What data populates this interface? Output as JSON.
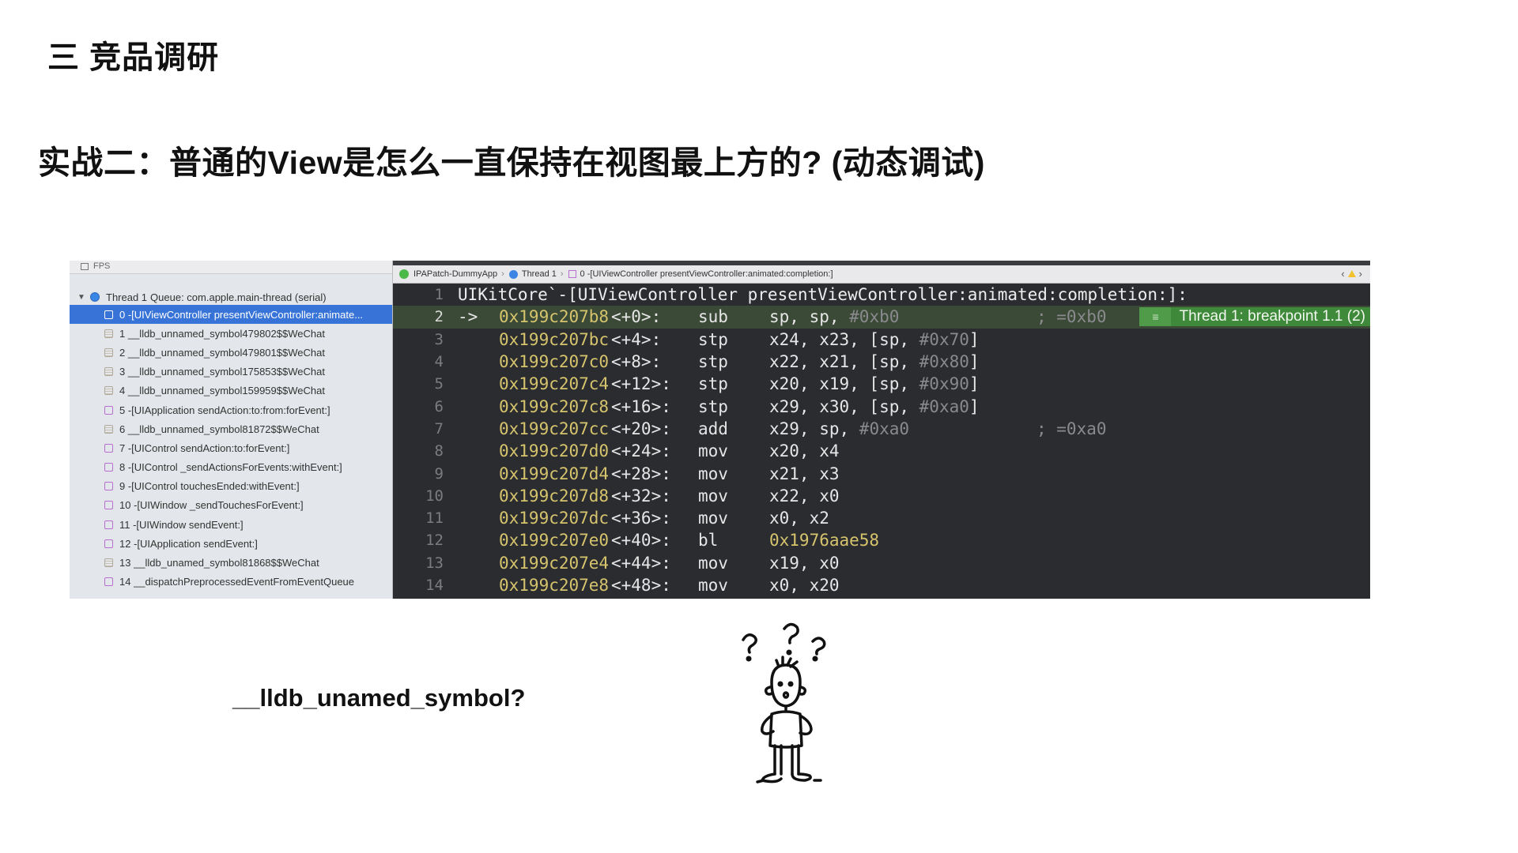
{
  "slide": {
    "section_title": "三 竞品调研",
    "heading": "实战二：普通的View是怎么一直保持在视图最上方的? (动态调试)",
    "question": "__lldb_unamed_symbol?"
  },
  "navigator": {
    "toolbar_label": "FPS",
    "thread_label": "Thread 1",
    "thread_queue": "Queue: com.apple.main-thread (serial)",
    "frames": [
      {
        "label": "0 -[UIViewController presentViewController:animate...",
        "kind": "objc",
        "selected": true
      },
      {
        "label": "1 __lldb_unnamed_symbol479802$$WeChat",
        "kind": "sym"
      },
      {
        "label": "2 __lldb_unnamed_symbol479801$$WeChat",
        "kind": "sym"
      },
      {
        "label": "3 __lldb_unnamed_symbol175853$$WeChat",
        "kind": "sym"
      },
      {
        "label": "4 __lldb_unnamed_symbol159959$$WeChat",
        "kind": "sym"
      },
      {
        "label": "5 -[UIApplication sendAction:to:from:forEvent:]",
        "kind": "objc"
      },
      {
        "label": "6 __lldb_unnamed_symbol81872$$WeChat",
        "kind": "sym"
      },
      {
        "label": "7 -[UIControl sendAction:to:forEvent:]",
        "kind": "objc"
      },
      {
        "label": "8 -[UIControl _sendActionsForEvents:withEvent:]",
        "kind": "objc"
      },
      {
        "label": "9 -[UIControl touchesEnded:withEvent:]",
        "kind": "objc"
      },
      {
        "label": "10 -[UIWindow _sendTouchesForEvent:]",
        "kind": "objc"
      },
      {
        "label": "11 -[UIWindow sendEvent:]",
        "kind": "objc"
      },
      {
        "label": "12 -[UIApplication sendEvent:]",
        "kind": "objc"
      },
      {
        "label": "13 __lldb_unamed_symbol81868$$WeChat",
        "kind": "sym"
      },
      {
        "label": "14 __dispatchPreprocessedEventFromEventQueue",
        "kind": "objc"
      }
    ]
  },
  "jumpbar": {
    "app": "IPAPatch-DummyApp",
    "thread": "Thread 1",
    "frame": "0 -[UIViewController presentViewController:animated:completion:]"
  },
  "disassembly": {
    "header": {
      "line": "1",
      "text": "UIKitCore`-[UIViewController presentViewController:animated:completion:]:"
    },
    "breakpoint_label": "Thread 1: breakpoint 1.1 (2)",
    "lines": [
      {
        "ln": "2",
        "arrow": "->",
        "addr": "0x199c207b8",
        "off": "<+0>:",
        "mnem": "sub",
        "ops": "sp, sp, ",
        "imm": "#0xb0",
        "comment": "; =0xb0",
        "current": true
      },
      {
        "ln": "3",
        "arrow": "",
        "addr": "0x199c207bc",
        "off": "<+4>:",
        "mnem": "stp",
        "ops": "x24, x23, [sp, ",
        "imm": "#0x70",
        "tail": "]",
        "comment": ""
      },
      {
        "ln": "4",
        "arrow": "",
        "addr": "0x199c207c0",
        "off": "<+8>:",
        "mnem": "stp",
        "ops": "x22, x21, [sp, ",
        "imm": "#0x80",
        "tail": "]",
        "comment": ""
      },
      {
        "ln": "5",
        "arrow": "",
        "addr": "0x199c207c4",
        "off": "<+12>:",
        "mnem": "stp",
        "ops": "x20, x19, [sp, ",
        "imm": "#0x90",
        "tail": "]",
        "comment": ""
      },
      {
        "ln": "6",
        "arrow": "",
        "addr": "0x199c207c8",
        "off": "<+16>:",
        "mnem": "stp",
        "ops": "x29, x30, [sp, ",
        "imm": "#0xa0",
        "tail": "]",
        "comment": ""
      },
      {
        "ln": "7",
        "arrow": "",
        "addr": "0x199c207cc",
        "off": "<+20>:",
        "mnem": "add",
        "ops": "x29, sp, ",
        "imm": "#0xa0",
        "comment": "; =0xa0"
      },
      {
        "ln": "8",
        "arrow": "",
        "addr": "0x199c207d0",
        "off": "<+24>:",
        "mnem": "mov",
        "ops": "x20, x4",
        "comment": ""
      },
      {
        "ln": "9",
        "arrow": "",
        "addr": "0x199c207d4",
        "off": "<+28>:",
        "mnem": "mov",
        "ops": "x21, x3",
        "comment": ""
      },
      {
        "ln": "10",
        "arrow": "",
        "addr": "0x199c207d8",
        "off": "<+32>:",
        "mnem": "mov",
        "ops": "x22, x0",
        "comment": ""
      },
      {
        "ln": "11",
        "arrow": "",
        "addr": "0x199c207dc",
        "off": "<+36>:",
        "mnem": "mov",
        "ops": "x0, x2",
        "comment": ""
      },
      {
        "ln": "12",
        "arrow": "",
        "addr": "0x199c207e0",
        "off": "<+40>:",
        "mnem": "bl",
        "ops": "0x1976aae58",
        "target": true,
        "comment": ""
      },
      {
        "ln": "13",
        "arrow": "",
        "addr": "0x199c207e4",
        "off": "<+44>:",
        "mnem": "mov",
        "ops": "x19, x0",
        "comment": ""
      },
      {
        "ln": "14",
        "arrow": "",
        "addr": "0x199c207e8",
        "off": "<+48>:",
        "mnem": "mov",
        "ops": "x0, x20",
        "comment": ""
      }
    ]
  }
}
